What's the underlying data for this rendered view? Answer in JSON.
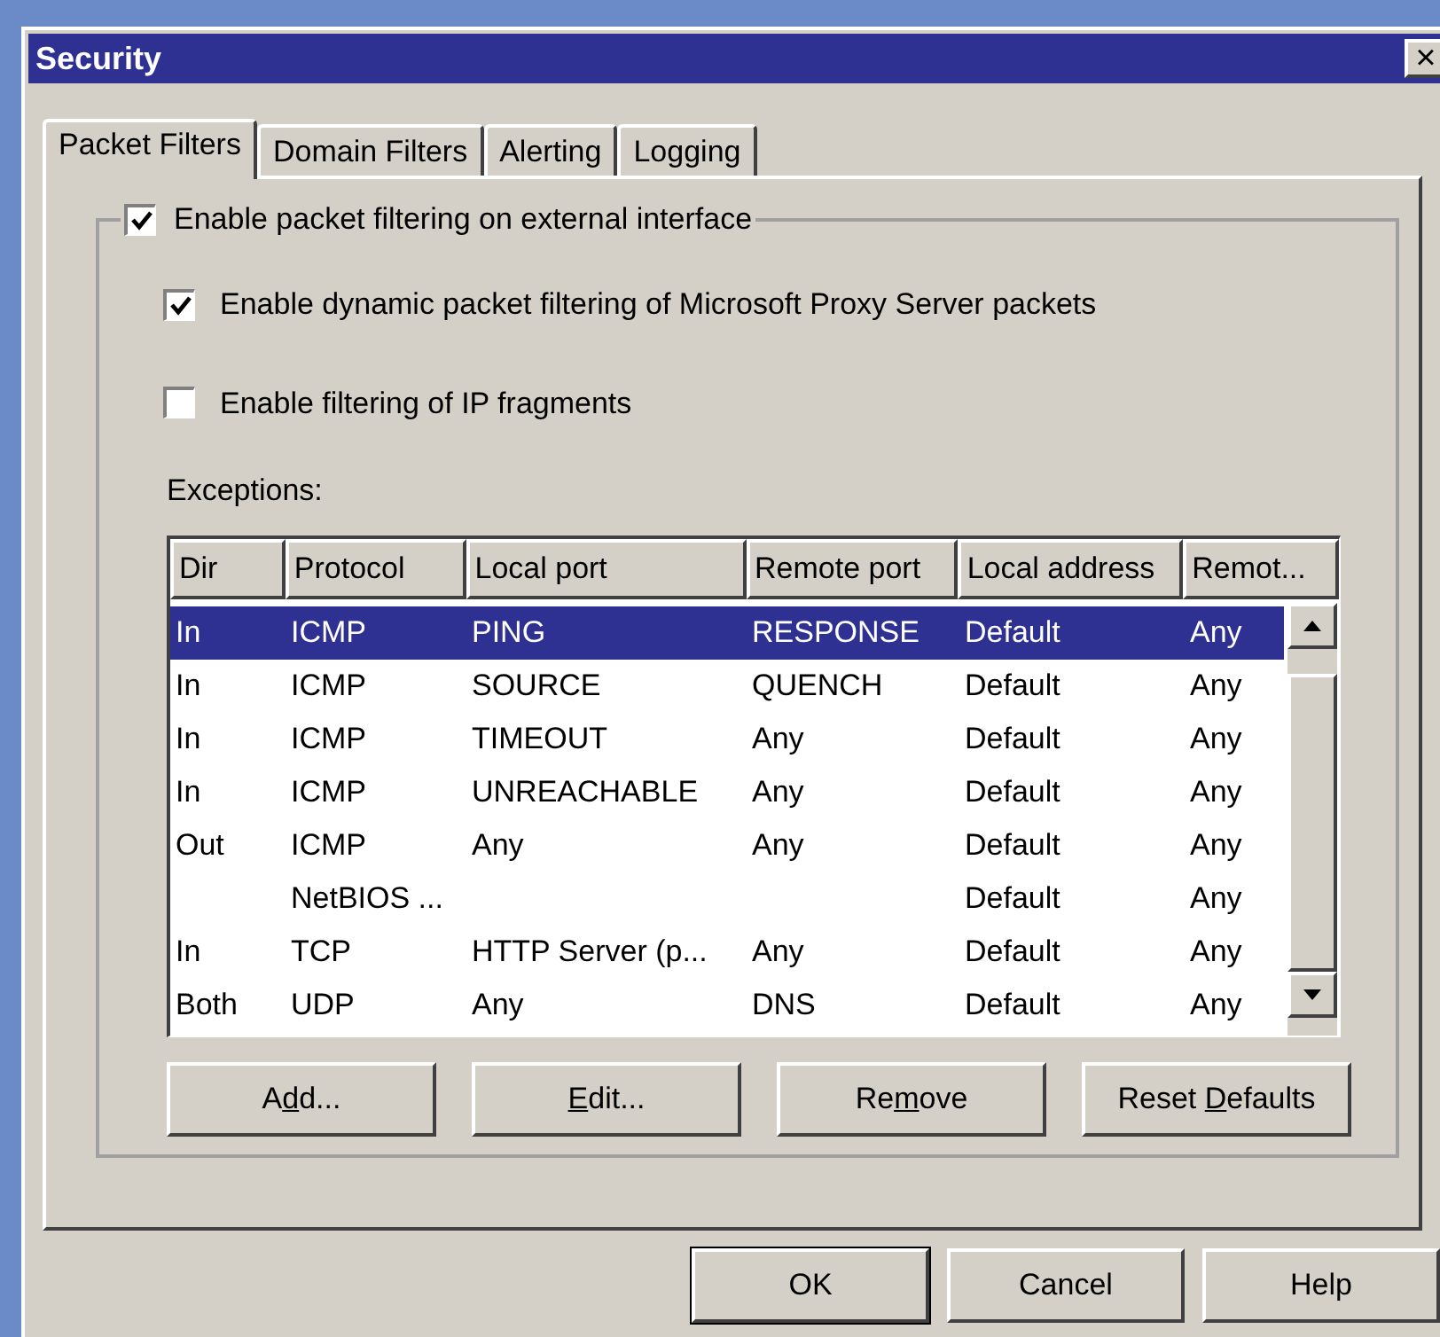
{
  "window": {
    "title": "Security",
    "close": "×"
  },
  "tabs": [
    {
      "label": "Packet Filters",
      "selected": true
    },
    {
      "label": "Domain Filters",
      "selected": false
    },
    {
      "label": "Alerting",
      "selected": false
    },
    {
      "label": "Logging",
      "selected": false
    }
  ],
  "group": {
    "label": "Enable packet filtering on external interface",
    "checked": true
  },
  "options": [
    {
      "label": "Enable dynamic packet filtering of Microsoft Proxy Server packets",
      "checked": true
    },
    {
      "label": "Enable filtering of IP fragments",
      "checked": false
    }
  ],
  "exceptions_label": "Exceptions:",
  "table": {
    "columns": [
      "Dir",
      "Protocol",
      "Local port",
      "Remote port",
      "Local address",
      "Remot..."
    ],
    "rows": [
      {
        "cells": [
          "In",
          "ICMP",
          "PING",
          "RESPONSE",
          "Default",
          "Any"
        ],
        "selected": true
      },
      {
        "cells": [
          "In",
          "ICMP",
          "SOURCE",
          "QUENCH",
          "Default",
          "Any"
        ],
        "selected": false
      },
      {
        "cells": [
          "In",
          "ICMP",
          "TIMEOUT",
          "Any",
          "Default",
          "Any"
        ],
        "selected": false
      },
      {
        "cells": [
          "In",
          "ICMP",
          "UNREACHABLE",
          "Any",
          "Default",
          "Any"
        ],
        "selected": false
      },
      {
        "cells": [
          "Out",
          "ICMP",
          "Any",
          "Any",
          "Default",
          "Any"
        ],
        "selected": false
      },
      {
        "cells": [
          "",
          "NetBIOS ...",
          "",
          "",
          "Default",
          "Any"
        ],
        "selected": false
      },
      {
        "cells": [
          "In",
          "TCP",
          "HTTP Server (p...",
          "Any",
          "Default",
          "Any"
        ],
        "selected": false
      },
      {
        "cells": [
          "Both",
          "UDP",
          "Any",
          "DNS",
          "Default",
          "Any"
        ],
        "selected": false
      }
    ]
  },
  "table_buttons": [
    {
      "before": "A",
      "access_key": "d",
      "after": "d..."
    },
    {
      "access_key": "E",
      "after": "dit..."
    },
    {
      "before": "Re",
      "access_key": "m",
      "after": "ove"
    },
    {
      "before": "Reset ",
      "access_key": "D",
      "after": "efaults"
    }
  ],
  "dialog_buttons": [
    {
      "label": "OK",
      "default": true
    },
    {
      "label": "Cancel",
      "default": false
    },
    {
      "label": "Help",
      "default": false
    }
  ]
}
